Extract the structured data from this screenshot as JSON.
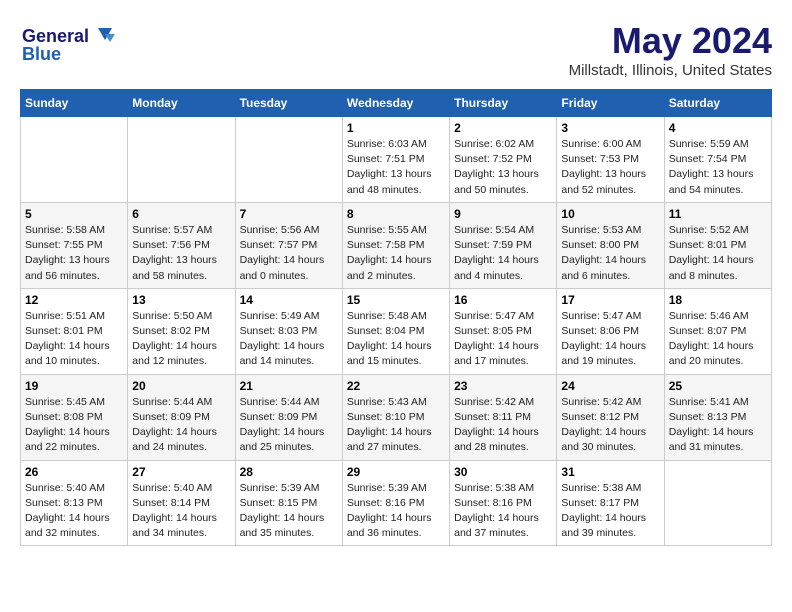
{
  "logo": {
    "line1": "General",
    "line2": "Blue"
  },
  "title": "May 2024",
  "subtitle": "Millstadt, Illinois, United States",
  "weekdays": [
    "Sunday",
    "Monday",
    "Tuesday",
    "Wednesday",
    "Thursday",
    "Friday",
    "Saturday"
  ],
  "weeks": [
    [
      {
        "day": "",
        "info": ""
      },
      {
        "day": "",
        "info": ""
      },
      {
        "day": "",
        "info": ""
      },
      {
        "day": "1",
        "info": "Sunrise: 6:03 AM\nSunset: 7:51 PM\nDaylight: 13 hours\nand 48 minutes."
      },
      {
        "day": "2",
        "info": "Sunrise: 6:02 AM\nSunset: 7:52 PM\nDaylight: 13 hours\nand 50 minutes."
      },
      {
        "day": "3",
        "info": "Sunrise: 6:00 AM\nSunset: 7:53 PM\nDaylight: 13 hours\nand 52 minutes."
      },
      {
        "day": "4",
        "info": "Sunrise: 5:59 AM\nSunset: 7:54 PM\nDaylight: 13 hours\nand 54 minutes."
      }
    ],
    [
      {
        "day": "5",
        "info": "Sunrise: 5:58 AM\nSunset: 7:55 PM\nDaylight: 13 hours\nand 56 minutes."
      },
      {
        "day": "6",
        "info": "Sunrise: 5:57 AM\nSunset: 7:56 PM\nDaylight: 13 hours\nand 58 minutes."
      },
      {
        "day": "7",
        "info": "Sunrise: 5:56 AM\nSunset: 7:57 PM\nDaylight: 14 hours\nand 0 minutes."
      },
      {
        "day": "8",
        "info": "Sunrise: 5:55 AM\nSunset: 7:58 PM\nDaylight: 14 hours\nand 2 minutes."
      },
      {
        "day": "9",
        "info": "Sunrise: 5:54 AM\nSunset: 7:59 PM\nDaylight: 14 hours\nand 4 minutes."
      },
      {
        "day": "10",
        "info": "Sunrise: 5:53 AM\nSunset: 8:00 PM\nDaylight: 14 hours\nand 6 minutes."
      },
      {
        "day": "11",
        "info": "Sunrise: 5:52 AM\nSunset: 8:01 PM\nDaylight: 14 hours\nand 8 minutes."
      }
    ],
    [
      {
        "day": "12",
        "info": "Sunrise: 5:51 AM\nSunset: 8:01 PM\nDaylight: 14 hours\nand 10 minutes."
      },
      {
        "day": "13",
        "info": "Sunrise: 5:50 AM\nSunset: 8:02 PM\nDaylight: 14 hours\nand 12 minutes."
      },
      {
        "day": "14",
        "info": "Sunrise: 5:49 AM\nSunset: 8:03 PM\nDaylight: 14 hours\nand 14 minutes."
      },
      {
        "day": "15",
        "info": "Sunrise: 5:48 AM\nSunset: 8:04 PM\nDaylight: 14 hours\nand 15 minutes."
      },
      {
        "day": "16",
        "info": "Sunrise: 5:47 AM\nSunset: 8:05 PM\nDaylight: 14 hours\nand 17 minutes."
      },
      {
        "day": "17",
        "info": "Sunrise: 5:47 AM\nSunset: 8:06 PM\nDaylight: 14 hours\nand 19 minutes."
      },
      {
        "day": "18",
        "info": "Sunrise: 5:46 AM\nSunset: 8:07 PM\nDaylight: 14 hours\nand 20 minutes."
      }
    ],
    [
      {
        "day": "19",
        "info": "Sunrise: 5:45 AM\nSunset: 8:08 PM\nDaylight: 14 hours\nand 22 minutes."
      },
      {
        "day": "20",
        "info": "Sunrise: 5:44 AM\nSunset: 8:09 PM\nDaylight: 14 hours\nand 24 minutes."
      },
      {
        "day": "21",
        "info": "Sunrise: 5:44 AM\nSunset: 8:09 PM\nDaylight: 14 hours\nand 25 minutes."
      },
      {
        "day": "22",
        "info": "Sunrise: 5:43 AM\nSunset: 8:10 PM\nDaylight: 14 hours\nand 27 minutes."
      },
      {
        "day": "23",
        "info": "Sunrise: 5:42 AM\nSunset: 8:11 PM\nDaylight: 14 hours\nand 28 minutes."
      },
      {
        "day": "24",
        "info": "Sunrise: 5:42 AM\nSunset: 8:12 PM\nDaylight: 14 hours\nand 30 minutes."
      },
      {
        "day": "25",
        "info": "Sunrise: 5:41 AM\nSunset: 8:13 PM\nDaylight: 14 hours\nand 31 minutes."
      }
    ],
    [
      {
        "day": "26",
        "info": "Sunrise: 5:40 AM\nSunset: 8:13 PM\nDaylight: 14 hours\nand 32 minutes."
      },
      {
        "day": "27",
        "info": "Sunrise: 5:40 AM\nSunset: 8:14 PM\nDaylight: 14 hours\nand 34 minutes."
      },
      {
        "day": "28",
        "info": "Sunrise: 5:39 AM\nSunset: 8:15 PM\nDaylight: 14 hours\nand 35 minutes."
      },
      {
        "day": "29",
        "info": "Sunrise: 5:39 AM\nSunset: 8:16 PM\nDaylight: 14 hours\nand 36 minutes."
      },
      {
        "day": "30",
        "info": "Sunrise: 5:38 AM\nSunset: 8:16 PM\nDaylight: 14 hours\nand 37 minutes."
      },
      {
        "day": "31",
        "info": "Sunrise: 5:38 AM\nSunset: 8:17 PM\nDaylight: 14 hours\nand 39 minutes."
      },
      {
        "day": "",
        "info": ""
      }
    ]
  ]
}
